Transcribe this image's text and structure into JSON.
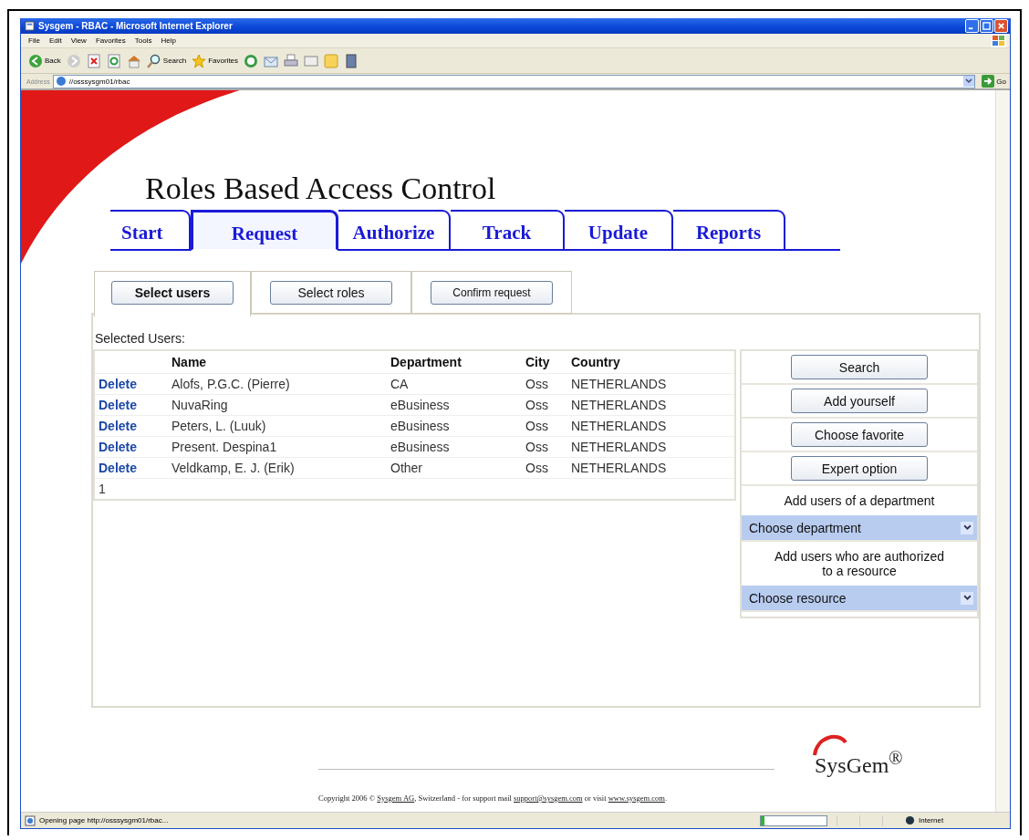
{
  "window": {
    "title": "Sysgem - RBAC - Microsoft Internet Explorer"
  },
  "menu": [
    "File",
    "Edit",
    "View",
    "Favorites",
    "Tools",
    "Help"
  ],
  "toolbar": {
    "back": "Back",
    "search": "Search",
    "favorites": "Favorites"
  },
  "address_bar": {
    "label": "Address",
    "url": "//osssysgm01/rbac",
    "go": "Go"
  },
  "page": {
    "heading": "Roles Based Access Control",
    "tabs": [
      {
        "label": "Start",
        "selected": false
      },
      {
        "label": "Request",
        "selected": true
      },
      {
        "label": "Authorize",
        "selected": false
      },
      {
        "label": "Track",
        "selected": false
      },
      {
        "label": "Update",
        "selected": false
      },
      {
        "label": "Reports",
        "selected": false
      }
    ],
    "subtabs": [
      {
        "label": "Select users",
        "selected": true
      },
      {
        "label": "Select roles",
        "selected": false
      },
      {
        "label": "Confirm  request",
        "selected": false
      }
    ],
    "section_label": "Selected Users:",
    "table": {
      "columns": [
        "Name",
        "Department",
        "City",
        "Country"
      ],
      "rows": [
        {
          "action": "Delete",
          "cells": [
            "Alofs, P.G.C. (Pierre)",
            "CA",
            "Oss",
            "NETHERLANDS"
          ]
        },
        {
          "action": "Delete",
          "cells": [
            "NuvaRing",
            "eBusiness",
            "Oss",
            "NETHERLANDS"
          ]
        },
        {
          "action": "Delete",
          "cells": [
            "Peters, L. (Luuk)",
            "eBusiness",
            "Oss",
            "NETHERLANDS"
          ]
        },
        {
          "action": "Delete",
          "cells": [
            "Present. Despina1",
            "eBusiness",
            "Oss",
            "NETHERLANDS"
          ]
        },
        {
          "action": "Delete",
          "cells": [
            "Veldkamp, E. J. (Erik)",
            "Other",
            "Oss",
            "NETHERLANDS"
          ]
        }
      ],
      "footer": "1"
    },
    "side": [
      {
        "kind": "button",
        "label": "Search"
      },
      {
        "kind": "button",
        "label": "Add yourself"
      },
      {
        "kind": "button",
        "label": "Choose favorite"
      },
      {
        "kind": "button",
        "label": "Expert option"
      },
      {
        "kind": "text",
        "label": "Add users of a department"
      },
      {
        "kind": "select",
        "label": "Choose department"
      },
      {
        "kind": "text",
        "label": "Add users who are authorized to a resource"
      },
      {
        "kind": "select",
        "label": "Choose resource"
      }
    ],
    "logo": "SysGem$^{®}$",
    "copyright": [
      {
        "kind": "text",
        "text": "Copyright 2006 © "
      },
      {
        "kind": "link",
        "text": "Sysgem AG"
      },
      {
        "kind": "text",
        "text": ", Switzerland - for support mail "
      },
      {
        "kind": "link",
        "text": "support@sysgem.com"
      },
      {
        "kind": "text",
        "text": " or visit "
      },
      {
        "kind": "link",
        "text": "www.sysgem.com"
      },
      {
        "kind": "text",
        "text": "."
      }
    ]
  },
  "status_bar": {
    "text": "Opening page http://osssysgm01/rbac...",
    "progress": {
      "level": 0.06
    },
    "zone": "Internet"
  }
}
